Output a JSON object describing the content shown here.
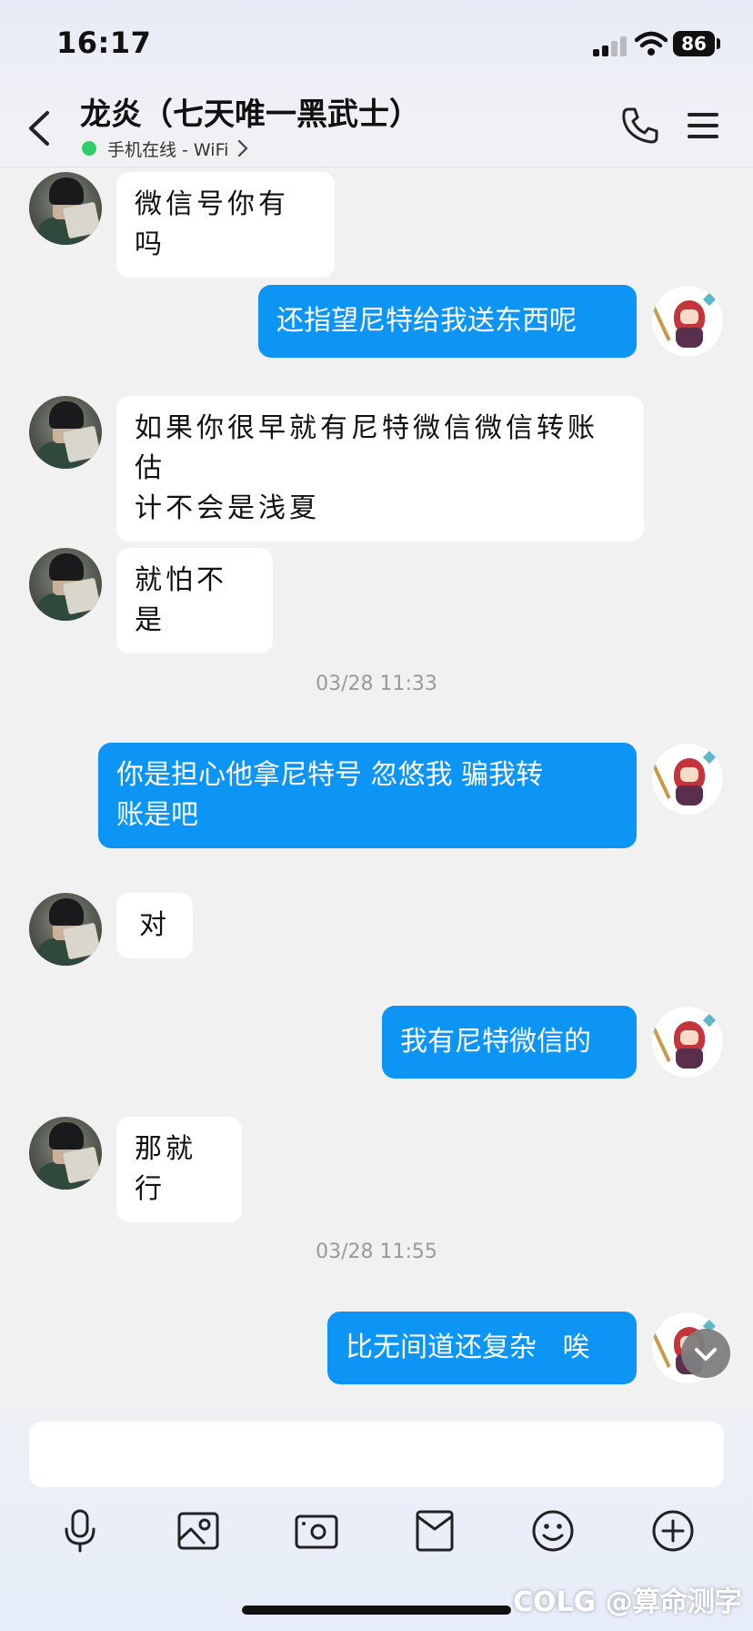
{
  "status_bar": {
    "time": "16:17",
    "battery": "86"
  },
  "header": {
    "title": "龙炎（七天唯一黑武士）",
    "presence": "手机在线 - WiFi",
    "presence_color": "#2fd06a"
  },
  "messages": [
    {
      "side": "in",
      "text": "微信号你有吗"
    },
    {
      "side": "out",
      "text": "还指望尼特给我送东西呢"
    },
    {
      "side": "in",
      "line1": "如果你很早就有尼特微信微信转账估",
      "line2": "计不会是浅夏"
    },
    {
      "side": "in",
      "text": "就怕不是"
    },
    {
      "timestamp": "03/28 11:33"
    },
    {
      "side": "out",
      "line1": "你是担心他拿尼特号  忽悠我  骗我转",
      "line2": "账是吧"
    },
    {
      "side": "in",
      "text": "对"
    },
    {
      "side": "out",
      "text": "我有尼特微信的"
    },
    {
      "side": "in",
      "text": "那就行"
    },
    {
      "timestamp": "03/28 11:55"
    },
    {
      "side": "out",
      "text": "比无间道还复杂   唉"
    }
  ],
  "composer": {
    "tools": [
      "microphone-icon",
      "image-icon",
      "camera-icon",
      "file-icon",
      "emoji-icon",
      "plus-icon"
    ]
  },
  "watermark": "COLG @算命测字",
  "colors": {
    "outgoing_bubble": "#0d95f5",
    "incoming_bubble": "#ffffff",
    "background": "#f1f1f1"
  }
}
